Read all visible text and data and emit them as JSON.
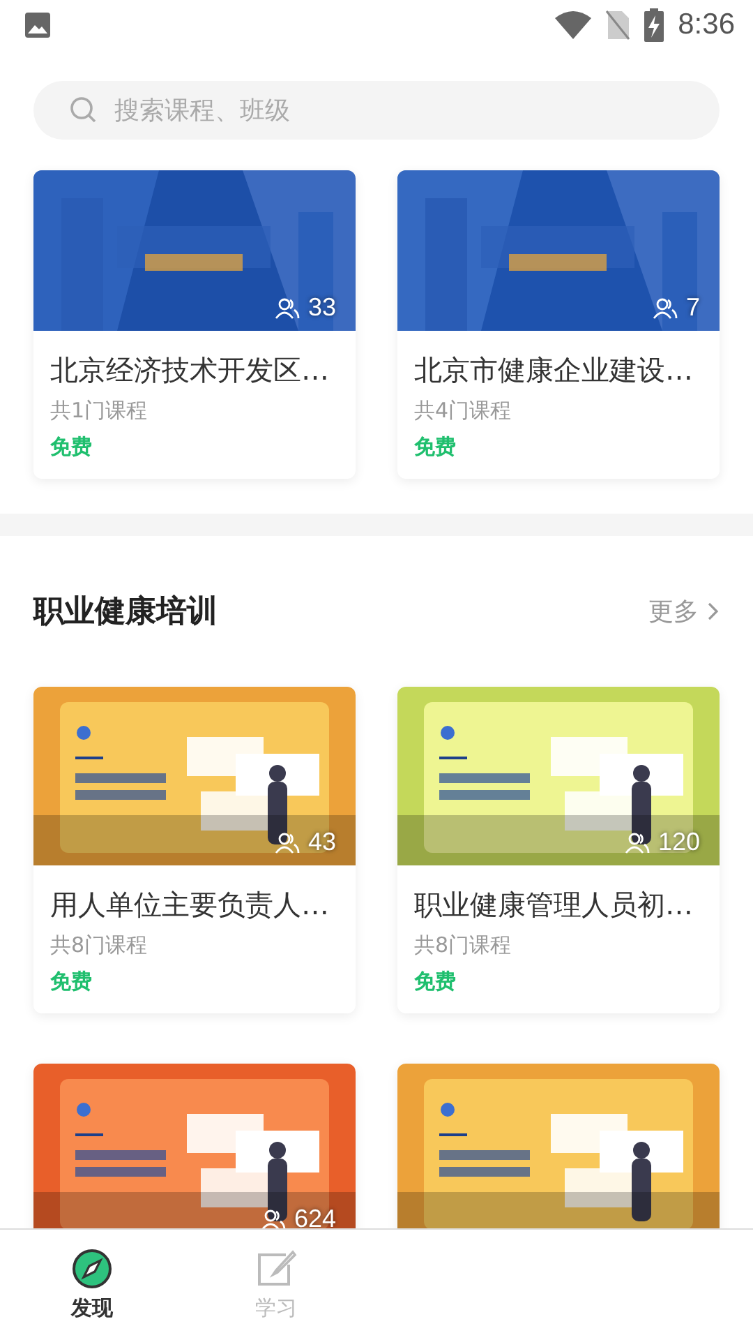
{
  "status_bar": {
    "time": "8:36"
  },
  "search": {
    "placeholder": "搜索课程、班级"
  },
  "top_classes": [
    {
      "title": "北京经济技术开发区…",
      "courses": "共1门课程",
      "price": "免费",
      "students": "33",
      "cover": {
        "kind": "picture"
      }
    },
    {
      "title": "北京市健康企业建设…",
      "courses": "共4门课程",
      "price": "免费",
      "students": "7",
      "cover": {
        "kind": "picture"
      }
    }
  ],
  "section": {
    "title": "职业健康培训",
    "more": "更多"
  },
  "section_classes": [
    {
      "title": "用人单位主要负责人…",
      "courses": "共8门课程",
      "price": "免费",
      "students": "43",
      "cover": {
        "kind": "picture"
      }
    },
    {
      "title": "职业健康管理人员初…",
      "courses": "共8门课程",
      "price": "免费",
      "students": "120",
      "cover": {
        "kind": "picture"
      }
    },
    {
      "students": "624",
      "cover": {
        "kind": "picture"
      }
    },
    {
      "cover": {
        "kind": "picture"
      }
    }
  ],
  "tab_bar": [
    {
      "label": "发现",
      "selected": true
    },
    {
      "label": "学习",
      "selected": false
    }
  ]
}
